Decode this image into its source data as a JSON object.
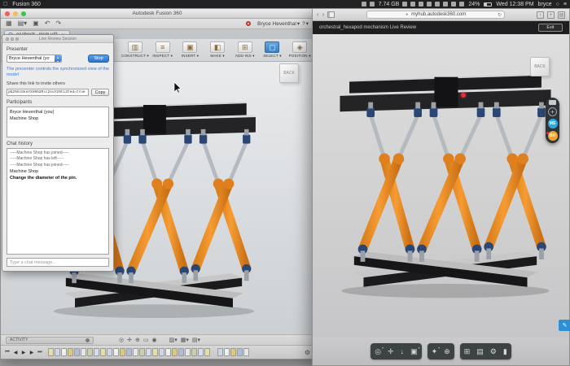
{
  "menubar": {
    "app_name": "Fusion 360",
    "memory": "7.74 GB",
    "battery_pct": "24%",
    "clock": "Wed 12:38 PM",
    "user": "bryce",
    "icons": [
      "display-icon",
      "shield-icon",
      "record-icon",
      "refresh-icon",
      "apps-icon",
      "keyboard-icon",
      "camera-icon",
      "bell-icon",
      "bluetooth-icon",
      "dropbox-icon",
      "time-machine-icon",
      "volume-icon",
      "wifi-icon",
      "search-icon",
      "list-icon"
    ]
  },
  "fusion": {
    "window_title": "Autodesk Fusion 360",
    "doc_tab": "ocahestr...nism v4*",
    "user_menu": "Bryce Heventhal",
    "help_label": "?",
    "ribbon": [
      "CONSTRUCT",
      "INSPECT",
      "INSERT",
      "MAKE",
      "ADD-INS",
      "SELECT",
      "POSITION"
    ],
    "viewcube": "BACK",
    "activity_label": "ACTIVITY"
  },
  "panel": {
    "title": "Live Review Session",
    "presenter_label": "Presenter",
    "presenter_value": "Bryce Heventhal (yo",
    "stop_button": "Stop",
    "info_text": "The presenter controls the synchronized view of the model",
    "share_label": "Share this link to invite others",
    "link_value": "pb25hcGkuYXV0b2Rlc2suY29tL2ted=true",
    "copy_button": "Copy",
    "participants_label": "Participants",
    "participants": [
      "Bryce Heventhal (you)",
      "Machine Shop"
    ],
    "chat_label": "Chat history",
    "chat": [
      "-----Machine Shop has joined-----",
      "-----Machine Shop has left-----",
      "-----Machine Shop has joined-----",
      "Machine Shop",
      "Change the diameter of the pin."
    ],
    "chat_placeholder": "Type a chat message..."
  },
  "browser": {
    "url": "myhub.autodesk360.com",
    "header_title": "orchestral_hexapod mechanism Live Review",
    "exit_button": "Exit",
    "viewcube": "BACK",
    "avatars": [
      {
        "initials": "MS",
        "color": "#29abe2"
      },
      {
        "initials": "BH",
        "color": "#f2a33c"
      }
    ],
    "toolbar_icons": [
      "orbit-icon",
      "pan-icon",
      "zoom-icon",
      "camera-icon",
      "render-icon",
      "explode-icon",
      "model-browser-icon",
      "properties-icon",
      "settings-icon",
      "fullscreen-icon"
    ]
  },
  "colors": {
    "accent_blue": "#2f7fd3",
    "cylinder_orange": "#f0922b",
    "joint_blue": "#2a4674",
    "avatar_blue": "#29abe2",
    "avatar_orange": "#f2a33c",
    "laser_red": "#e23131"
  }
}
